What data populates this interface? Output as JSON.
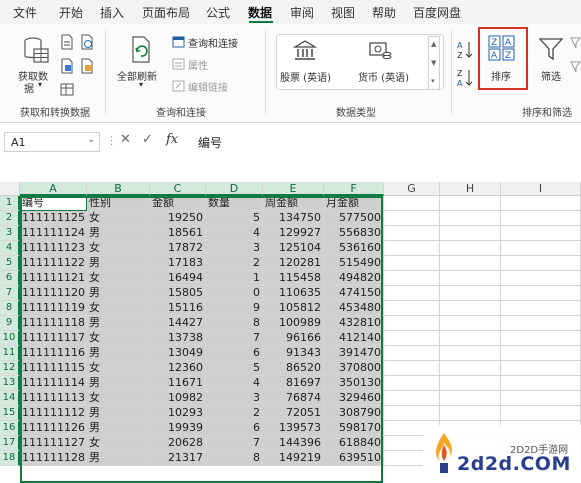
{
  "menu": {
    "tabs": [
      "文件",
      "开始",
      "插入",
      "页面布局",
      "公式",
      "数据",
      "审阅",
      "视图",
      "帮助",
      "百度网盘"
    ],
    "active": "数据"
  },
  "ribbon": {
    "get_data": {
      "label": "获取数",
      "label2": "据",
      "group": "获取和转换数据"
    },
    "refresh": {
      "label": "全部刷新",
      "query_connections": "查询和连接",
      "properties": "属性",
      "edit_links": "编辑链接",
      "group": "查询和连接"
    },
    "data_types": {
      "stocks": "股票 (英语)",
      "currency": "货币 (英语)",
      "group": "数据类型"
    },
    "sort": {
      "sort_label": "排序",
      "filter_label": "筛选",
      "group": "排序和筛选"
    }
  },
  "formula_bar": {
    "name_box": "A1",
    "cancel_symbol": "✕",
    "enter_symbol": "✓",
    "fx_symbol": "fx",
    "content": "编号"
  },
  "sheet": {
    "columns": [
      "A",
      "B",
      "C",
      "D",
      "E",
      "F",
      "G",
      "H",
      "I"
    ],
    "headers": [
      "编号",
      "性别",
      "金额",
      "数量",
      "周金额",
      "月金额"
    ],
    "rows": [
      [
        "111111125",
        "女",
        "19250",
        "5",
        "134750",
        "577500"
      ],
      [
        "111111124",
        "男",
        "18561",
        "4",
        "129927",
        "556830"
      ],
      [
        "111111123",
        "女",
        "17872",
        "3",
        "125104",
        "536160"
      ],
      [
        "111111122",
        "男",
        "17183",
        "2",
        "120281",
        "515490"
      ],
      [
        "111111121",
        "女",
        "16494",
        "1",
        "115458",
        "494820"
      ],
      [
        "111111120",
        "男",
        "15805",
        "0",
        "110635",
        "474150"
      ],
      [
        "111111119",
        "女",
        "15116",
        "9",
        "105812",
        "453480"
      ],
      [
        "111111118",
        "男",
        "14427",
        "8",
        "100989",
        "432810"
      ],
      [
        "111111117",
        "女",
        "13738",
        "7",
        "96166",
        "412140"
      ],
      [
        "111111116",
        "男",
        "13049",
        "6",
        "91343",
        "391470"
      ],
      [
        "111111115",
        "女",
        "12360",
        "5",
        "86520",
        "370800"
      ],
      [
        "111111114",
        "男",
        "11671",
        "4",
        "81697",
        "350130"
      ],
      [
        "111111113",
        "女",
        "10982",
        "3",
        "76874",
        "329460"
      ],
      [
        "111111112",
        "男",
        "10293",
        "2",
        "72051",
        "308790"
      ],
      [
        "111111126",
        "男",
        "19939",
        "6",
        "139573",
        "598170"
      ],
      [
        "111111127",
        "女",
        "20628",
        "7",
        "144396",
        "618840"
      ],
      [
        "111111128",
        "男",
        "21317",
        "8",
        "149219",
        "639510"
      ]
    ]
  },
  "watermark": {
    "site": "2D2D手游网",
    "logo": "2d2d.COM"
  }
}
